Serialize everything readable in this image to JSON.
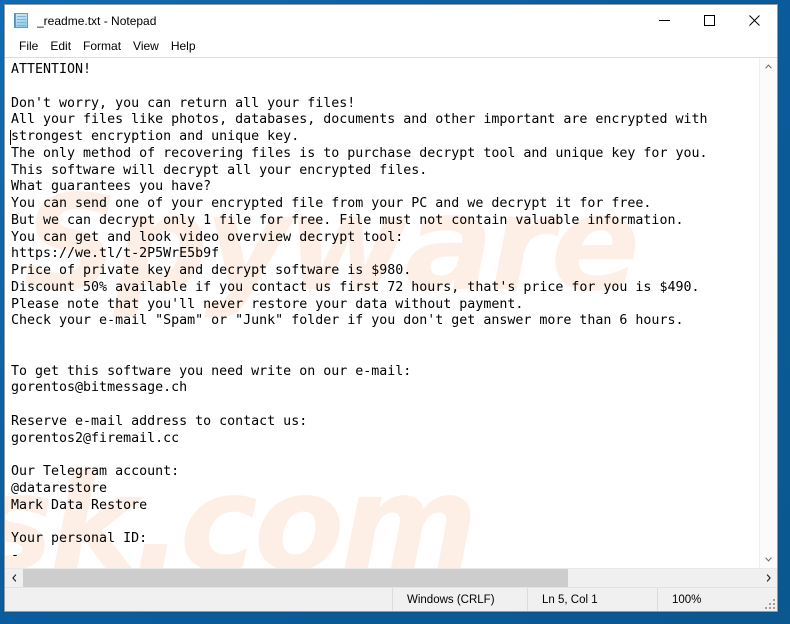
{
  "window": {
    "title": "_readme.txt - Notepad",
    "icon": "notepad-document-icon",
    "controls": {
      "minimize_label": "Minimize",
      "maximize_label": "Maximize",
      "close_label": "Close"
    }
  },
  "menu": {
    "items": [
      {
        "label": "File"
      },
      {
        "label": "Edit"
      },
      {
        "label": "Format"
      },
      {
        "label": "View"
      },
      {
        "label": "Help"
      }
    ]
  },
  "document": {
    "caret_line_index": 4,
    "lines": [
      "ATTENTION!",
      "",
      "Don't worry, you can return all your files!",
      "All your files like photos, databases, documents and other important are encrypted with",
      "strongest encryption and unique key.",
      "The only method of recovering files is to purchase decrypt tool and unique key for you.",
      "This software will decrypt all your encrypted files.",
      "What guarantees you have?",
      "You can send one of your encrypted file from your PC and we decrypt it for free.",
      "But we can decrypt only 1 file for free. File must not contain valuable information.",
      "You can get and look video overview decrypt tool:",
      "https://we.tl/t-2P5WrE5b9f",
      "Price of private key and decrypt software is $980.",
      "Discount 50% available if you contact us first 72 hours, that's price for you is $490.",
      "Please note that you'll never restore your data without payment.",
      "Check your e-mail \"Spam\" or \"Junk\" folder if you don't get answer more than 6 hours.",
      "",
      "",
      "To get this software you need write on our e-mail:",
      "gorentos@bitmessage.ch",
      "",
      "Reserve e-mail address to contact us:",
      "gorentos2@firemail.cc",
      "",
      "Our Telegram account:",
      "@datarestore",
      "Mark Data Restore",
      "",
      "Your personal ID:",
      "-"
    ]
  },
  "watermark": {
    "line1": "Spyware",
    "line2": "sk.com"
  },
  "scrollbars": {
    "vertical": {
      "up_arrow": "chevron-up-icon",
      "down_arrow": "chevron-down-icon"
    },
    "horizontal": {
      "left_arrow": "chevron-left-icon",
      "right_arrow": "chevron-right-icon",
      "thumb_width_percent": "74"
    }
  },
  "status_bar": {
    "encoding": "Windows (CRLF)",
    "position": "Ln 5, Col 1",
    "zoom": "100%"
  },
  "colors": {
    "desktop_blue": "#0b63a8",
    "window_bg": "#ffffff",
    "status_bg": "#f0f0f0",
    "scroll_thumb": "#cdcdcd",
    "watermark": "#fdefe6",
    "text": "#000000"
  }
}
